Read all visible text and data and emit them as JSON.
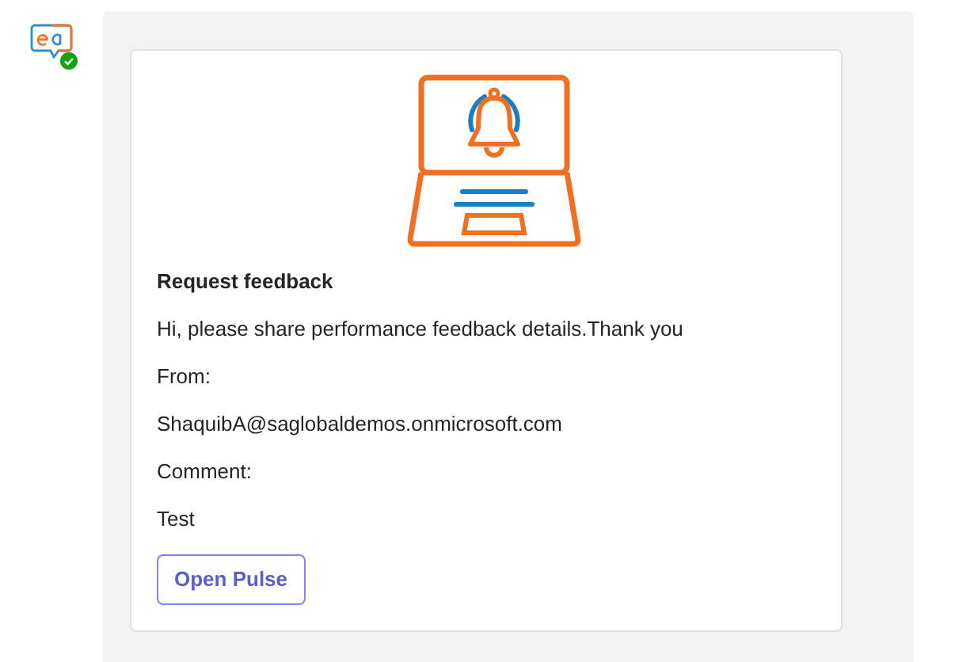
{
  "card": {
    "title": "Request feedback",
    "lines": [
      "Hi, please share performance feedback details.Thank you",
      "From:",
      "ShaquibA@saglobaldemos.onmicrosoft.com",
      "Comment:",
      "Test"
    ],
    "button": "Open Pulse"
  },
  "sender": {
    "online": true
  }
}
